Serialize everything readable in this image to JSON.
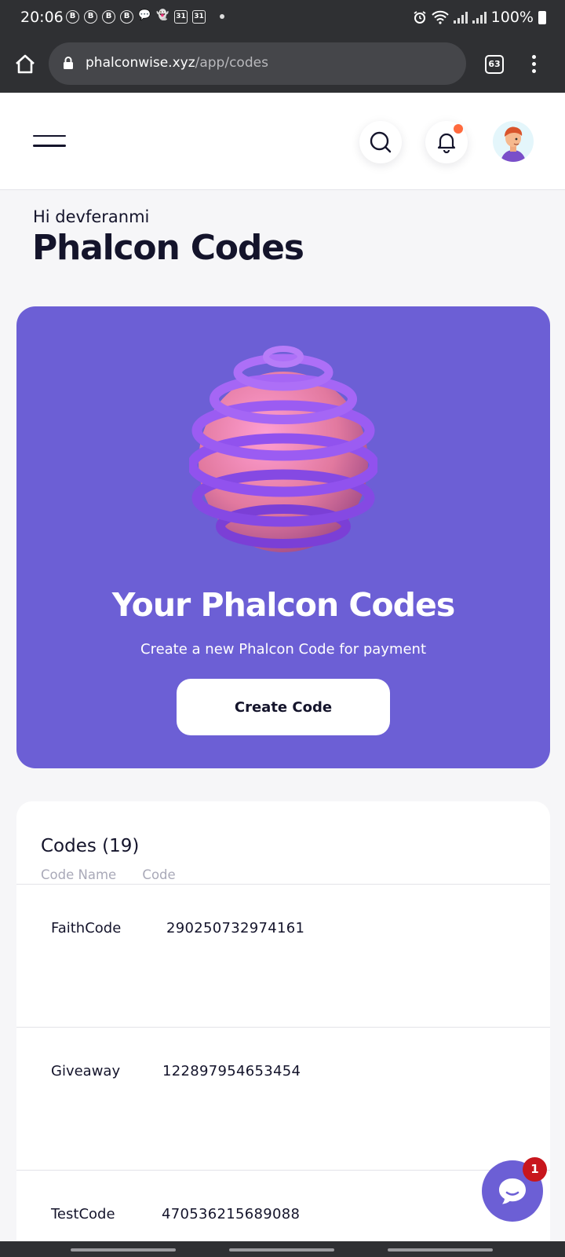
{
  "status_bar": {
    "time": "20:06",
    "battery": "100%",
    "notif_icons": [
      "B",
      "B",
      "B",
      "B",
      "💬",
      "👻",
      "31",
      "31"
    ]
  },
  "browser": {
    "url_domain": "phalconwise.xyz",
    "url_path": "/app/codes",
    "tab_count": "63"
  },
  "header": {
    "greeting": "Hi devferanmi",
    "title": "Phalcon Codes"
  },
  "hero": {
    "title": "Your Phalcon Codes",
    "subtitle": "Create a new Phalcon Code for payment",
    "button_label": "Create Code"
  },
  "codes": {
    "heading": "Codes (19)",
    "columns": [
      "Code Name",
      "Code"
    ],
    "rows": [
      {
        "name": "FaithCode",
        "code": "290250732974161"
      },
      {
        "name": "Giveaway",
        "code": "122897954653454"
      },
      {
        "name": "TestCode",
        "code": "470536215689088"
      }
    ]
  },
  "chat": {
    "badge": "1"
  },
  "colors": {
    "accent": "#6c5fd5",
    "ink": "#14142b",
    "notification": "#ff6a3d",
    "badge": "#c8161d"
  }
}
